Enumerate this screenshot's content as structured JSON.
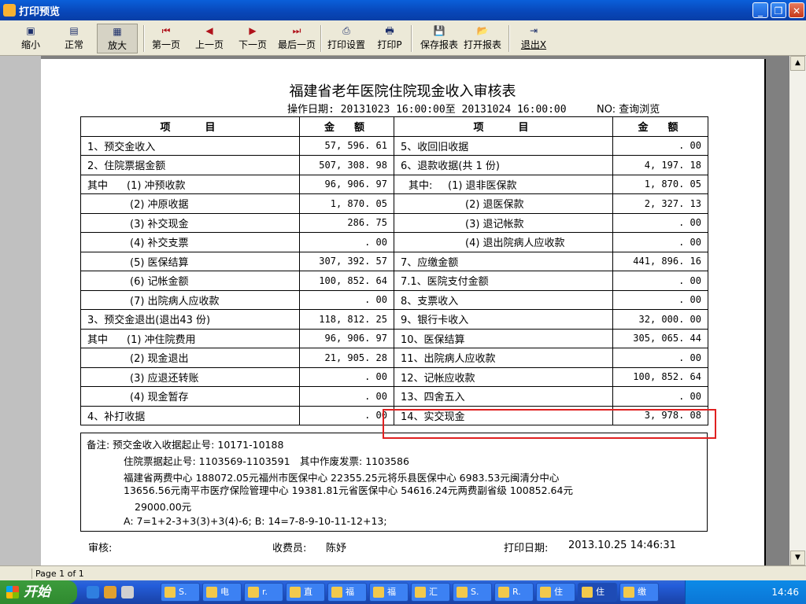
{
  "window": {
    "title": "打印预览"
  },
  "toolbar": {
    "zoom_out": "缩小",
    "normal": "正常",
    "zoom_in": "放大",
    "first_page": "第一页",
    "prev_page": "上一页",
    "next_page": "下一页",
    "last_page": "最后一页",
    "print_setup": "打印设置",
    "print": "打印P",
    "save_report": "保存报表",
    "open_report": "打开报表",
    "exit": "退出X"
  },
  "report": {
    "title": "福建省老年医院住院现金收入审核表",
    "subtitle": "操作日期: 20131023 16:00:00至 20131024 16:00:00",
    "no": "NO: 查询浏览",
    "headers": {
      "item": "项　　目",
      "amount": "金　额"
    },
    "rows": [
      {
        "l_label": "1、预交金收入",
        "l_val": "57, 596. 61",
        "r_label": "5、收回旧收据",
        "r_val": ". 00"
      },
      {
        "l_label": "2、住院票据金额",
        "l_val": "507, 308. 98",
        "r_label": "6、退款收据(共 1 份)",
        "r_val": "4, 197. 18"
      },
      {
        "l_prefix": "其中",
        "l_label": "(1) 冲预收款",
        "l_val": "96, 906. 97",
        "r_prefix": "其中:",
        "r_label": "(1) 退非医保款",
        "r_val": "1, 870. 05"
      },
      {
        "l_label": "(2) 冲原收据",
        "l_val": "1, 870. 05",
        "r_label": "(2) 退医保款",
        "r_val": "2, 327. 13"
      },
      {
        "l_label": "(3) 补交现金",
        "l_val": "286. 75",
        "r_label": "(3) 退记帐款",
        "r_val": ". 00"
      },
      {
        "l_label": "(4) 补交支票",
        "l_val": ". 00",
        "r_label": "(4) 退出院病人应收款",
        "r_val": ". 00"
      },
      {
        "l_label": "(5) 医保结算",
        "l_val": "307, 392. 57",
        "r_label": "7、应缴金额",
        "r_val": "441, 896. 16"
      },
      {
        "l_label": "(6) 记帐金额",
        "l_val": "100, 852. 64",
        "r_label": "7.1、医院支付金额",
        "r_val": ". 00"
      },
      {
        "l_label": "(7) 出院病人应收款",
        "l_val": ". 00",
        "r_label": "8、支票收入",
        "r_val": ". 00"
      },
      {
        "l_label": "3、预交金退出(退出43 份)",
        "l_val": "118, 812. 25",
        "r_label": "9、银行卡收入",
        "r_val": "32, 000. 00"
      },
      {
        "l_prefix": "其中",
        "l_label": "(1) 冲住院费用",
        "l_val": "96, 906. 97",
        "r_label": "10、医保结算",
        "r_val": "305, 065. 44"
      },
      {
        "l_label": "(2) 现金退出",
        "l_val": "21, 905. 28",
        "r_label": "11、出院病人应收款",
        "r_val": ". 00"
      },
      {
        "l_label": "(3) 应退还转账",
        "l_val": ". 00",
        "r_label": "12、记帐应收款",
        "r_val": "100, 852. 64"
      },
      {
        "l_label": "(4) 现金暂存",
        "l_val": ". 00",
        "r_label": "13、四舍五入",
        "r_val": ". 00"
      },
      {
        "l_label": "4、补打收据",
        "l_val": ". 00",
        "r_label": "14、实交现金",
        "r_val": "3, 978. 08"
      }
    ],
    "notes": [
      "备注: 预交金收入收据起止号: 10171-10188",
      "住院票据起止号: 1103569-1103591　其中作废发票: 1103586",
      "福建省两费中心 188072.05元福州市医保中心 22355.25元将乐县医保中心 6983.53元闽清分中心",
      "13656.56元南平市医疗保险管理中心 19381.81元省医保中心 54616.24元两费副省级 100852.64元",
      "29000.00元",
      "A: 7=1+2-3+3(3)+3(4)-6; B: 14=7-8-9-10-11-12+13;"
    ],
    "footer": {
      "reviewer_label": "审核:",
      "cashier_label": "收费员:",
      "cashier": "陈妤",
      "print_date_label": "打印日期:",
      "print_date": "2013.10.25 14:46:31"
    }
  },
  "statusbar": {
    "page": "Page 1 of 1"
  },
  "taskbar": {
    "start": "开始",
    "tasks": [
      "S.",
      "电",
      "r.",
      "直",
      "福",
      "福",
      "汇",
      "S.",
      "R.",
      "住",
      "住",
      "缴"
    ],
    "clock": "14:46"
  },
  "colors": {
    "highlight_box": "#e02020",
    "titlebar": "#0846b8"
  }
}
